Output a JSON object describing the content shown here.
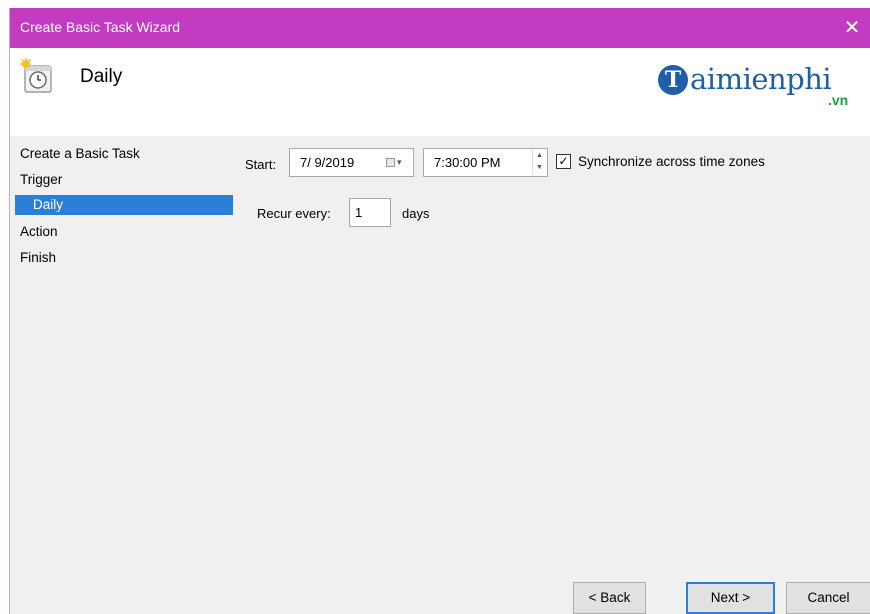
{
  "window": {
    "title": "Create Basic Task Wizard",
    "close_glyph": "✕"
  },
  "header": {
    "title": "Daily",
    "icon": "scheduled-task-icon"
  },
  "logo": {
    "initial": "T",
    "text": "aimienphi",
    "sub": ".vn"
  },
  "sidebar": {
    "items": [
      {
        "label": "Create a Basic Task"
      },
      {
        "label": "Trigger"
      },
      {
        "label": "Daily",
        "selected": true
      },
      {
        "label": "Action"
      },
      {
        "label": "Finish"
      }
    ]
  },
  "trigger": {
    "start_label": "Start:",
    "start_date": "7/ 9/2019",
    "start_time": "7:30:00 PM",
    "sync_label": "Synchronize across time zones",
    "sync_checked": true,
    "recur_label": "Recur every:",
    "recur_value": "1",
    "recur_unit": "days"
  },
  "buttons": {
    "back": "< Back",
    "next": "Next >",
    "cancel": "Cancel"
  },
  "colors": {
    "titlebar": "#c23bc0",
    "selection": "#2a7fd8",
    "logo": "#1e5fa8",
    "logo_sub": "#1aa33a"
  }
}
